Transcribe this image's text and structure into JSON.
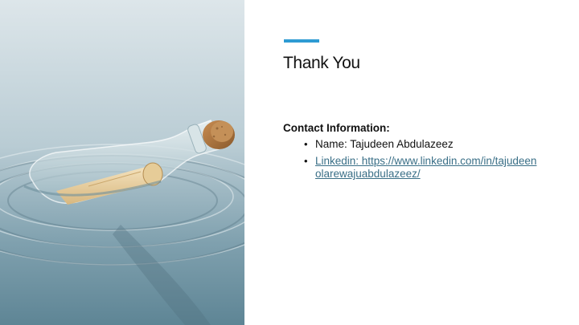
{
  "slide": {
    "title": "Thank You",
    "contact_heading": "Contact Information:",
    "bullets": [
      {
        "text": "Name: Tajudeen Abdulazeez",
        "is_link": false
      },
      {
        "text": "Linkedin: https://www.linkedin.com/in/tajudeenolarewajuabdulazeez/",
        "is_link": true
      }
    ],
    "bullet_glyph": "•"
  },
  "image": {
    "icon": "message-in-a-bottle-photo"
  },
  "colors": {
    "accent": "#2e9bd3",
    "link": "#3a6f87",
    "water_light": "#c9d9df",
    "water_dark": "#6f94a3"
  }
}
